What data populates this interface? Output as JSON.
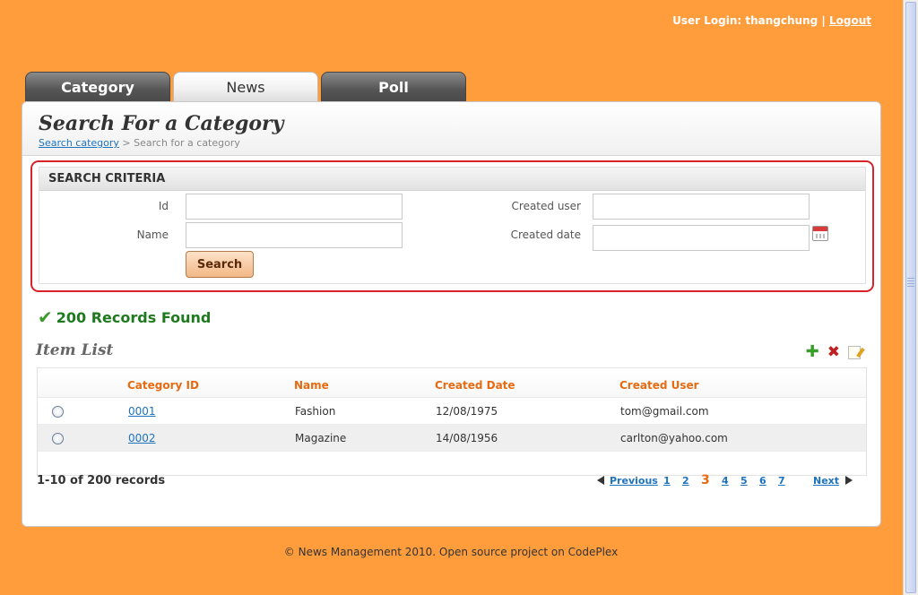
{
  "userbar": {
    "prefix": "User Login: thangchung",
    "separator": "|",
    "logout": "Logout"
  },
  "tabs": [
    {
      "label": "Category",
      "active": false
    },
    {
      "label": "News",
      "active": true
    },
    {
      "label": "Poll",
      "active": false
    }
  ],
  "header": {
    "title": "Search For a Category",
    "breadcrumb_link": "Search category",
    "breadcrumb_sep": ">",
    "breadcrumb_current": "Search for a category"
  },
  "criteria": {
    "title": "SEARCH CRITERIA",
    "id_label": "Id",
    "id_value": "",
    "name_label": "Name",
    "name_value": "",
    "created_user_label": "Created user",
    "created_user_value": "",
    "created_date_label": "Created date",
    "created_date_value": "",
    "search_button": "Search"
  },
  "records_found": "200 Records Found",
  "item_list": {
    "title": "Item List",
    "icons": [
      "add-icon",
      "delete-icon",
      "edit-icon"
    ],
    "columns": [
      "Category ID",
      "Name",
      "Created Date",
      "Created User"
    ],
    "rows": [
      {
        "id": "0001",
        "name": "Fashion",
        "date": "12/08/1975",
        "user": "tom@gmail.com"
      },
      {
        "id": "0002",
        "name": "Magazine",
        "date": "14/08/1956",
        "user": "carlton@yahoo.com"
      }
    ]
  },
  "pagination": {
    "summary": "1-10 of 200 records",
    "previous": "Previous",
    "pages": [
      "1",
      "2",
      "3",
      "4",
      "5",
      "6",
      "7"
    ],
    "current": "3",
    "next": "Next"
  },
  "footer": "© News Management 2010. Open source project on CodePlex",
  "colors": {
    "background": "#ff9d3d",
    "accent": "#e86a10",
    "link": "#1e73be",
    "highlight": "#d8232a"
  }
}
